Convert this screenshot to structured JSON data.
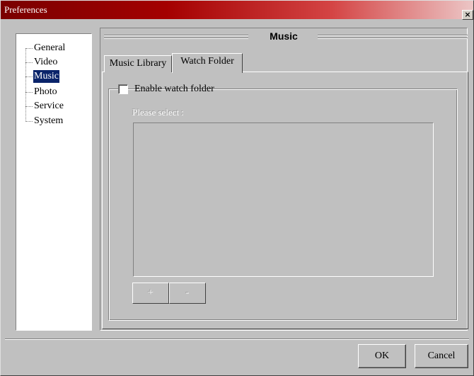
{
  "window": {
    "title": "Preferences",
    "close_label": "×"
  },
  "tree": {
    "items": [
      {
        "label": "General",
        "selected": false
      },
      {
        "label": "Video",
        "selected": false
      },
      {
        "label": "Music",
        "selected": true
      },
      {
        "label": "Photo",
        "selected": false
      },
      {
        "label": "Service",
        "selected": false
      },
      {
        "label": "System",
        "selected": false
      }
    ]
  },
  "section": {
    "title": "Music"
  },
  "tabs": [
    {
      "label": "Music Library",
      "active": false
    },
    {
      "label": "Watch Folder",
      "active": true
    }
  ],
  "watch_folder": {
    "enable_label": "Enable watch folder",
    "enabled": false,
    "select_label": "Please select :",
    "add_label": "+",
    "remove_label": "-"
  },
  "buttons": {
    "ok": "OK",
    "cancel": "Cancel"
  }
}
